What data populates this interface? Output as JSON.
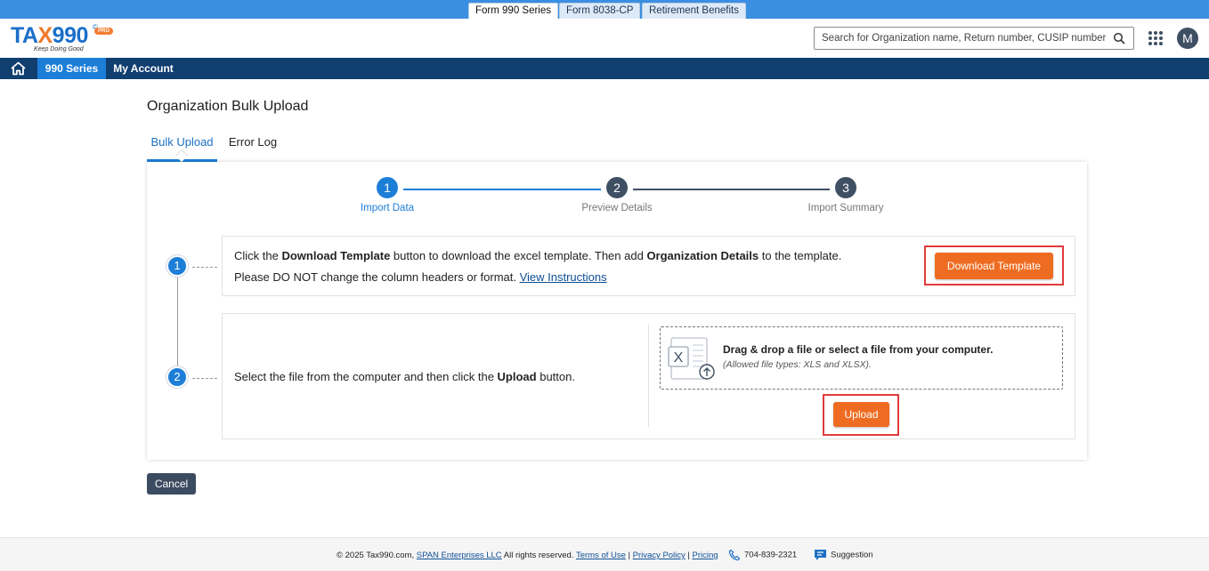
{
  "top_tabs": [
    {
      "label": "Form 990 Series",
      "active": true
    },
    {
      "label": "Form 8038-CP",
      "active": false
    },
    {
      "label": "Retirement Benefits",
      "active": false
    }
  ],
  "logo": {
    "text_main": "TA",
    "text_x": "X",
    "text_num": "990",
    "tagline": "Keep Doing Good",
    "badge": "PRO",
    "reg": "©"
  },
  "search": {
    "placeholder": "Search for Organization name, Return number, CUSIP number"
  },
  "avatar": {
    "initial": "M"
  },
  "nav": {
    "items": [
      {
        "label": "990 Series",
        "active": true
      },
      {
        "label": "My Account",
        "active": false
      }
    ]
  },
  "page": {
    "title": "Organization Bulk Upload",
    "tabs": [
      {
        "label": "Bulk Upload",
        "active": true
      },
      {
        "label": "Error Log",
        "active": false
      }
    ]
  },
  "stepper": {
    "steps": [
      {
        "number": "1",
        "label": "Import Data",
        "active": true
      },
      {
        "number": "2",
        "label": "Preview Details",
        "active": false
      },
      {
        "number": "3",
        "label": "Import Summary",
        "active": false
      }
    ]
  },
  "step1": {
    "number": "1",
    "line1_pre": "Click the ",
    "line1_b1": "Download Template",
    "line1_mid": " button to download the excel template. Then add ",
    "line1_b2": "Organization Details",
    "line1_post": " to the template.",
    "line2_pre": "Please DO NOT change the column headers or format. ",
    "line2_link": "View Instructions",
    "button": "Download Template"
  },
  "step2": {
    "number": "2",
    "text_pre": "Select the file from the computer and then click the ",
    "text_b": "Upload",
    "text_post": " button.",
    "drop_title": "Drag & drop a file or select a file from your computer.",
    "drop_sub": "(Allowed file types: XLS and XLSX).",
    "button": "Upload"
  },
  "cancel_button": "Cancel",
  "footer": {
    "copyright": "© 2025 Tax990.com, ",
    "company": "SPAN Enterprises LLC",
    "rights": " All rights reserved. ",
    "terms": "Terms of Use",
    "sep1": " | ",
    "privacy": "Privacy Policy",
    "sep2": " | ",
    "pricing": "Pricing",
    "phone": "704-839-2321",
    "suggestion": "Suggestion"
  },
  "colors": {
    "accent_blue": "#1d7ed8",
    "nav_dark": "#0f3e6f",
    "orange": "#ee6c21",
    "step_inactive": "#3f4f64"
  },
  "icons": [
    "home-icon",
    "search-icon",
    "apps-grid-icon",
    "excel-file-icon",
    "phone-icon",
    "suggestion-icon"
  ]
}
